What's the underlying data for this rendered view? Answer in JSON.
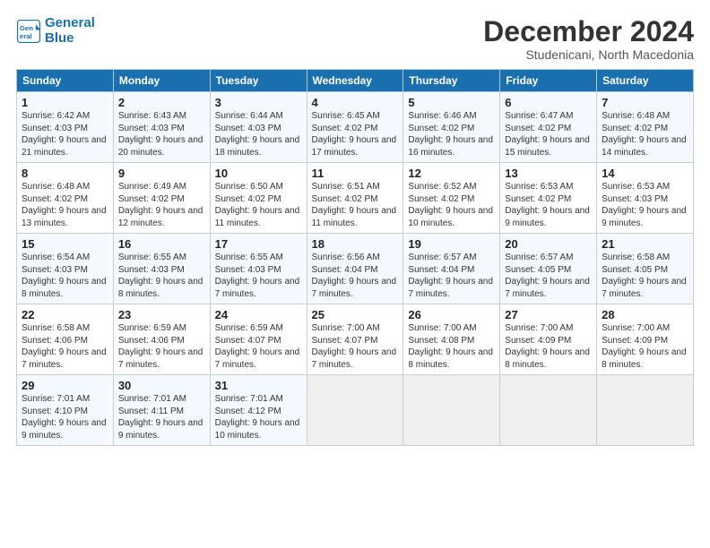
{
  "header": {
    "logo_line1": "General",
    "logo_line2": "Blue",
    "title": "December 2024",
    "subtitle": "Studenicani, North Macedonia"
  },
  "calendar": {
    "days_of_week": [
      "Sunday",
      "Monday",
      "Tuesday",
      "Wednesday",
      "Thursday",
      "Friday",
      "Saturday"
    ],
    "weeks": [
      [
        null,
        {
          "day": "2",
          "sunrise": "6:43 AM",
          "sunset": "4:03 PM",
          "daylight": "9 hours and 20 minutes."
        },
        {
          "day": "3",
          "sunrise": "6:44 AM",
          "sunset": "4:03 PM",
          "daylight": "9 hours and 18 minutes."
        },
        {
          "day": "4",
          "sunrise": "6:45 AM",
          "sunset": "4:02 PM",
          "daylight": "9 hours and 17 minutes."
        },
        {
          "day": "5",
          "sunrise": "6:46 AM",
          "sunset": "4:02 PM",
          "daylight": "9 hours and 16 minutes."
        },
        {
          "day": "6",
          "sunrise": "6:47 AM",
          "sunset": "4:02 PM",
          "daylight": "9 hours and 15 minutes."
        },
        {
          "day": "7",
          "sunrise": "6:48 AM",
          "sunset": "4:02 PM",
          "daylight": "9 hours and 14 minutes."
        }
      ],
      [
        {
          "day": "1",
          "sunrise": "6:42 AM",
          "sunset": "4:03 PM",
          "daylight": "9 hours and 21 minutes."
        },
        {
          "day": "8",
          "sunrise": "6:48 AM",
          "sunset": "4:02 PM",
          "daylight": "9 hours and 13 minutes."
        },
        {
          "day": "9",
          "sunrise": "6:49 AM",
          "sunset": "4:02 PM",
          "daylight": "9 hours and 12 minutes."
        },
        {
          "day": "10",
          "sunrise": "6:50 AM",
          "sunset": "4:02 PM",
          "daylight": "9 hours and 11 minutes."
        },
        {
          "day": "11",
          "sunrise": "6:51 AM",
          "sunset": "4:02 PM",
          "daylight": "9 hours and 11 minutes."
        },
        {
          "day": "12",
          "sunrise": "6:52 AM",
          "sunset": "4:02 PM",
          "daylight": "9 hours and 10 minutes."
        },
        {
          "day": "13",
          "sunrise": "6:53 AM",
          "sunset": "4:02 PM",
          "daylight": "9 hours and 9 minutes."
        },
        {
          "day": "14",
          "sunrise": "6:53 AM",
          "sunset": "4:03 PM",
          "daylight": "9 hours and 9 minutes."
        }
      ],
      [
        {
          "day": "15",
          "sunrise": "6:54 AM",
          "sunset": "4:03 PM",
          "daylight": "9 hours and 8 minutes."
        },
        {
          "day": "16",
          "sunrise": "6:55 AM",
          "sunset": "4:03 PM",
          "daylight": "9 hours and 8 minutes."
        },
        {
          "day": "17",
          "sunrise": "6:55 AM",
          "sunset": "4:03 PM",
          "daylight": "9 hours and 7 minutes."
        },
        {
          "day": "18",
          "sunrise": "6:56 AM",
          "sunset": "4:04 PM",
          "daylight": "9 hours and 7 minutes."
        },
        {
          "day": "19",
          "sunrise": "6:57 AM",
          "sunset": "4:04 PM",
          "daylight": "9 hours and 7 minutes."
        },
        {
          "day": "20",
          "sunrise": "6:57 AM",
          "sunset": "4:05 PM",
          "daylight": "9 hours and 7 minutes."
        },
        {
          "day": "21",
          "sunrise": "6:58 AM",
          "sunset": "4:05 PM",
          "daylight": "9 hours and 7 minutes."
        }
      ],
      [
        {
          "day": "22",
          "sunrise": "6:58 AM",
          "sunset": "4:06 PM",
          "daylight": "9 hours and 7 minutes."
        },
        {
          "day": "23",
          "sunrise": "6:59 AM",
          "sunset": "4:06 PM",
          "daylight": "9 hours and 7 minutes."
        },
        {
          "day": "24",
          "sunrise": "6:59 AM",
          "sunset": "4:07 PM",
          "daylight": "9 hours and 7 minutes."
        },
        {
          "day": "25",
          "sunrise": "7:00 AM",
          "sunset": "4:07 PM",
          "daylight": "9 hours and 7 minutes."
        },
        {
          "day": "26",
          "sunrise": "7:00 AM",
          "sunset": "4:08 PM",
          "daylight": "9 hours and 8 minutes."
        },
        {
          "day": "27",
          "sunrise": "7:00 AM",
          "sunset": "4:09 PM",
          "daylight": "9 hours and 8 minutes."
        },
        {
          "day": "28",
          "sunrise": "7:00 AM",
          "sunset": "4:09 PM",
          "daylight": "9 hours and 8 minutes."
        }
      ],
      [
        {
          "day": "29",
          "sunrise": "7:01 AM",
          "sunset": "4:10 PM",
          "daylight": "9 hours and 9 minutes."
        },
        {
          "day": "30",
          "sunrise": "7:01 AM",
          "sunset": "4:11 PM",
          "daylight": "9 hours and 9 minutes."
        },
        {
          "day": "31",
          "sunrise": "7:01 AM",
          "sunset": "4:12 PM",
          "daylight": "9 hours and 10 minutes."
        },
        null,
        null,
        null,
        null
      ]
    ]
  }
}
